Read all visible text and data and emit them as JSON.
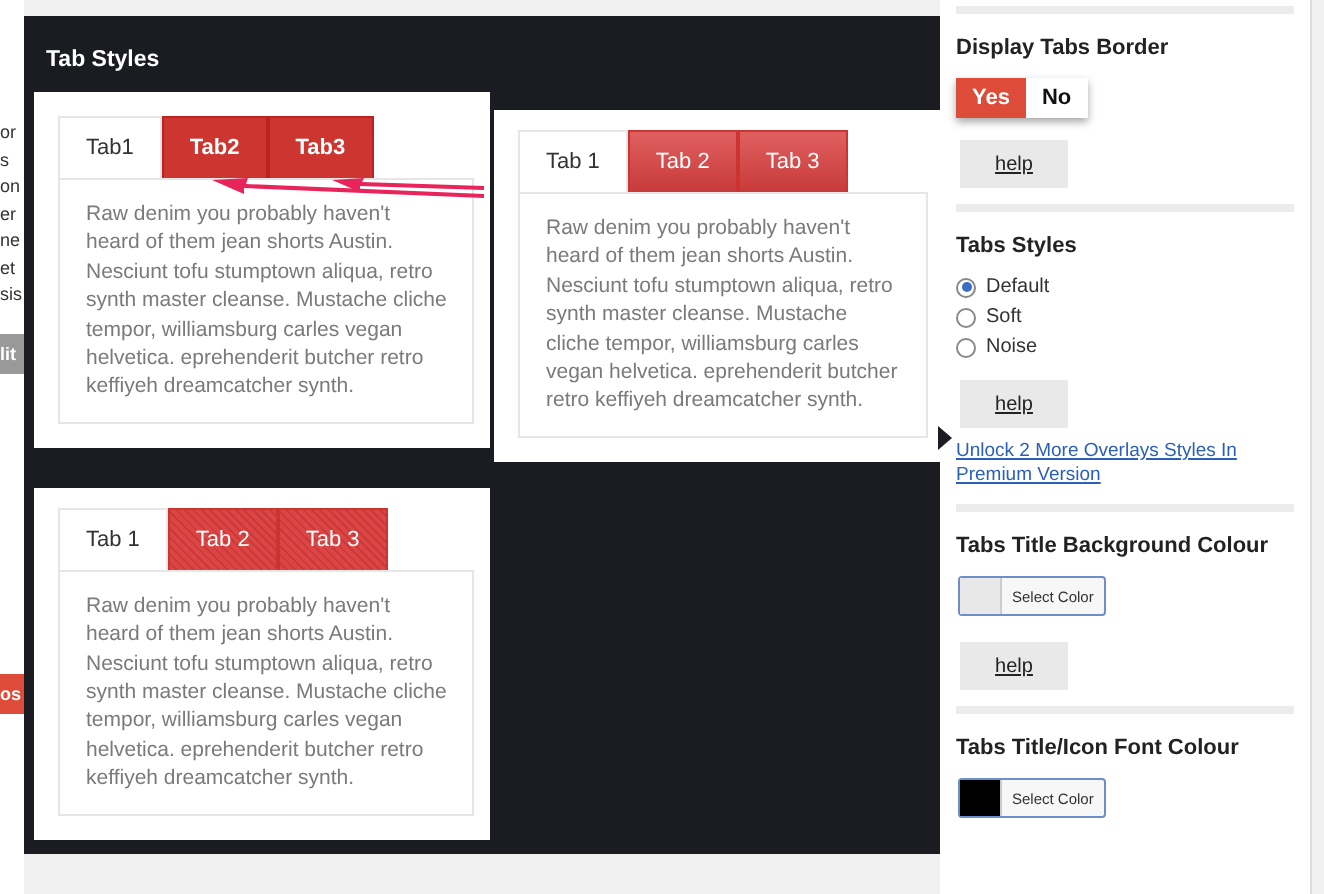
{
  "background_fragments": [
    "or",
    "s",
    "on",
    "er",
    "ne",
    "et",
    "sis"
  ],
  "background_buttons": [
    {
      "label": "lit",
      "kind": "grey"
    },
    {
      "label": "os",
      "kind": "red"
    }
  ],
  "overlay": {
    "title": "Tab Styles",
    "previews": [
      {
        "kind": "default",
        "tabs": [
          {
            "label": "Tab1",
            "selected": true
          },
          {
            "label": "Tab2",
            "selected": false
          },
          {
            "label": "Tab3",
            "selected": false
          }
        ],
        "text": "Raw denim you probably haven't heard of them jean shorts Austin. Nesciunt tofu stumptown aliqua, retro synth master cleanse. Mustache cliche tempor, williamsburg carles vegan helvetica. eprehenderit butcher retro keffiyeh dreamcatcher synth."
      },
      {
        "kind": "soft",
        "tabs": [
          {
            "label": "Tab 1",
            "selected": true
          },
          {
            "label": "Tab 2",
            "selected": false
          },
          {
            "label": "Tab 3",
            "selected": false
          }
        ],
        "text": "Raw denim you probably haven't heard of them jean shorts Austin. Nesciunt tofu stumptown aliqua, retro synth master cleanse. Mustache cliche tempor, williamsburg carles vegan helvetica. eprehenderit butcher retro keffiyeh dreamcatcher synth."
      },
      {
        "kind": "noise",
        "tabs": [
          {
            "label": "Tab 1",
            "selected": true
          },
          {
            "label": "Tab 2",
            "selected": false
          },
          {
            "label": "Tab 3",
            "selected": false
          }
        ],
        "text": "Raw denim you probably haven't heard of them jean shorts Austin. Nesciunt tofu stumptown aliqua, retro synth master cleanse. Mustache cliche tempor, williamsburg carles vegan helvetica. eprehenderit butcher retro keffiyeh dreamcatcher synth."
      }
    ]
  },
  "settings": [
    {
      "kind": "toggle",
      "title": "Display Tabs Border",
      "options": [
        {
          "label": "Yes",
          "selected": true
        },
        {
          "label": "No",
          "selected": false
        }
      ],
      "help": "help"
    },
    {
      "kind": "radio",
      "title": "Tabs Styles",
      "options": [
        {
          "label": "Default",
          "selected": true
        },
        {
          "label": "Soft",
          "selected": false
        },
        {
          "label": "Noise",
          "selected": false
        }
      ],
      "help": "help",
      "link": "Unlock 2 More Overlays Styles In Premium Version"
    },
    {
      "kind": "color",
      "title": "Tabs Title Background Colour",
      "color": "#e8e8e8",
      "button": "Select Color",
      "help": "help"
    },
    {
      "kind": "color",
      "title": "Tabs Title/Icon Font Colour",
      "color": "#000000",
      "button": "Select Color"
    }
  ]
}
